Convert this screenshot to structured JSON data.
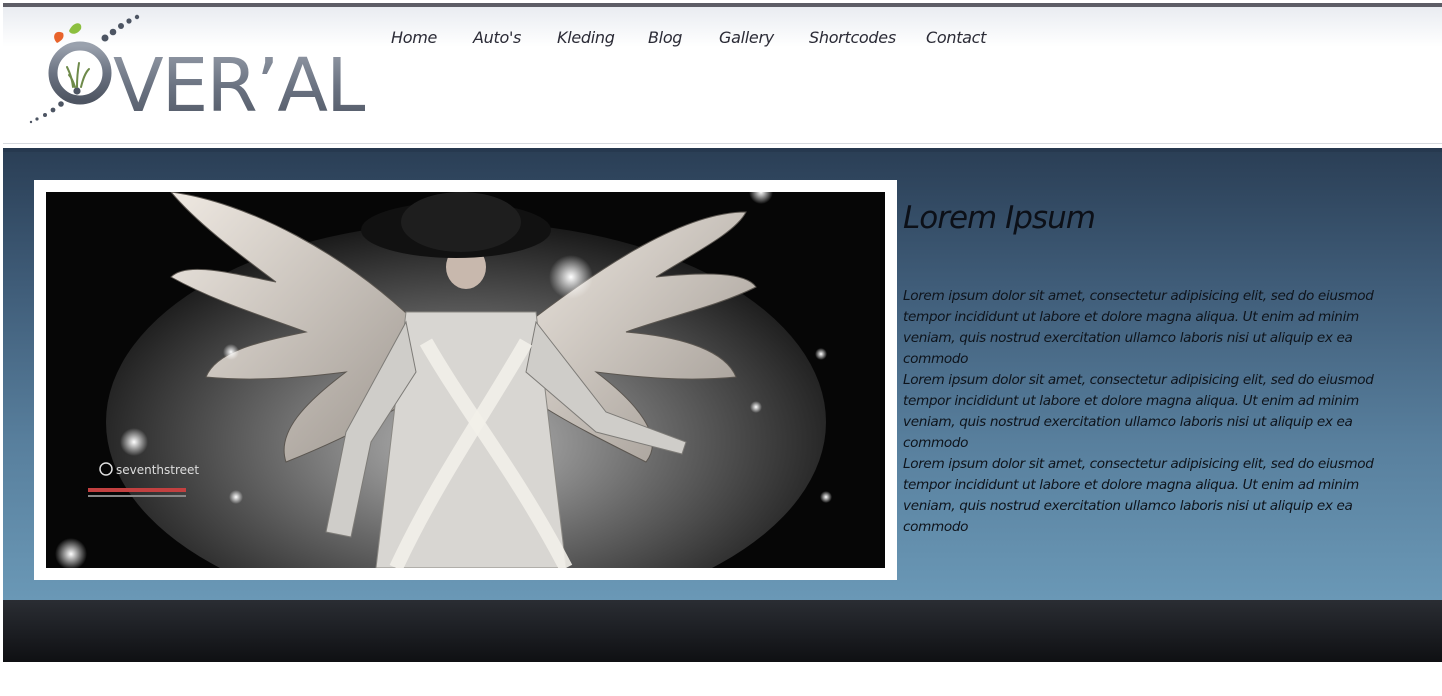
{
  "logo": {
    "text": "OVER’ALL"
  },
  "nav": {
    "items": [
      {
        "label": "Home"
      },
      {
        "label": "Auto's"
      },
      {
        "label": "Kleding"
      },
      {
        "label": "Blog"
      },
      {
        "label": "Gallery"
      },
      {
        "label": "Shortcodes"
      },
      {
        "label": "Contact"
      }
    ]
  },
  "hero": {
    "image_watermark": "seventhstreet",
    "heading": "Lorem Ipsum",
    "paragraphs": [
      "Lorem ipsum dolor sit amet, consectetur adipisicing elit, sed do eiusmod tempor incididunt ut labore et dolore magna aliqua. Ut enim ad minim veniam, quis nostrud exercitation ullamco laboris nisi ut aliquip ex ea commodo",
      "Lorem ipsum dolor sit amet, consectetur adipisicing elit, sed do eiusmod tempor incididunt ut labore et dolore magna aliqua. Ut enim ad minim veniam, quis nostrud exercitation ullamco laboris nisi ut aliquip ex ea commodo",
      "Lorem ipsum dolor sit amet, consectetur adipisicing elit, sed do eiusmod tempor incididunt ut labore et dolore magna aliqua. Ut enim ad minim veniam, quis nostrud exercitation ullamco laboris nisi ut aliquip ex ea commodo"
    ]
  },
  "colors": {
    "accent_leaf_orange": "#e8632b",
    "accent_leaf_green": "#8cbf3f",
    "logo_gray": "#6f7786",
    "hero_top": "#2a3e55",
    "hero_bottom": "#6a98b6",
    "footer": "#121316"
  }
}
